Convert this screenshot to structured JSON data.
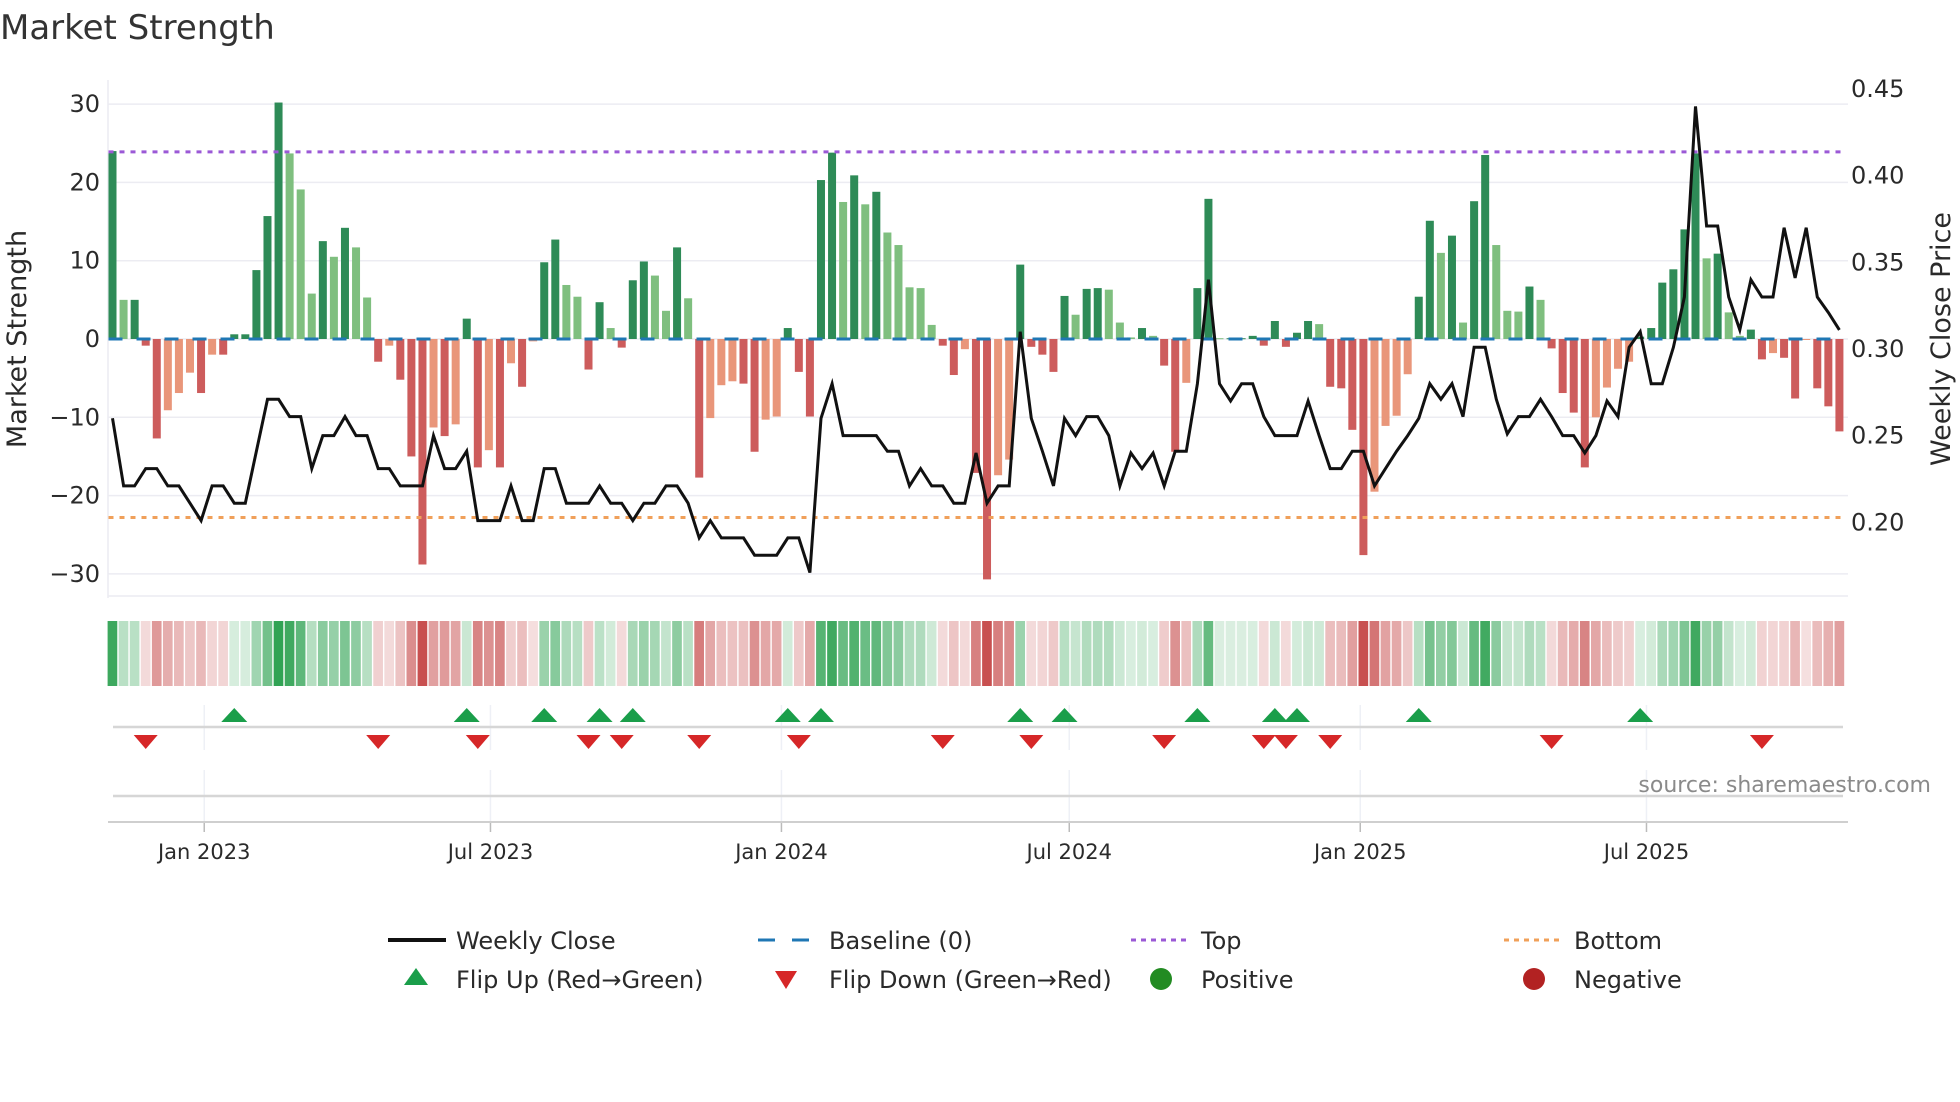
{
  "title": "Market Strength",
  "source": "source: sharemaestro.com",
  "colors": {
    "pos_strong": "#2e8b57",
    "pos_weak": "#7fbf7f",
    "neg_strong": "#cd5c5c",
    "neg_weak": "#e9967a",
    "line": "#111111",
    "baseline": "#1f77b4",
    "top": "#9b59d6",
    "bottom": "#f0a05a",
    "flip_up": "#1a9e4a",
    "flip_down": "#d62728",
    "positive": "#228b22",
    "negative": "#b22222"
  },
  "chart_data": {
    "type": "bar",
    "title": "Market Strength",
    "ylabel": "Market Strength",
    "y2label": "Weekly Close Price",
    "ylim": [
      -33,
      33
    ],
    "y2lim": [
      0.155,
      0.455
    ],
    "yticks": [
      "30",
      "20",
      "10",
      "0",
      "−10",
      "−20",
      "−30"
    ],
    "ytick_values": [
      30,
      20,
      10,
      0,
      -10,
      -20,
      -30
    ],
    "y2ticks": [
      "0.45",
      "0.40",
      "0.35",
      "0.30",
      "0.25",
      "0.20"
    ],
    "y2tick_values": [
      0.45,
      0.4,
      0.35,
      0.3,
      0.25,
      0.2
    ],
    "x_frequency": "weekly",
    "x_start": "2022-11-04",
    "x_ticks": [
      {
        "label": "Jan 2023",
        "date": "2023-01-01"
      },
      {
        "label": "Jul 2023",
        "date": "2023-07-01"
      },
      {
        "label": "Jan 2024",
        "date": "2024-01-01"
      },
      {
        "label": "Jul 2024",
        "date": "2024-07-01"
      },
      {
        "label": "Jan 2025",
        "date": "2025-01-01"
      },
      {
        "label": "Jul 2025",
        "date": "2025-07-01"
      }
    ],
    "top_level": 23.9,
    "bottom_level": -22.8,
    "baseline": 0,
    "strength": [
      24.0,
      5.0,
      5.0,
      -0.85,
      -12.7,
      -9.1,
      -6.9,
      -4.3,
      -6.9,
      -2.0,
      -2.0,
      0.6,
      0.6,
      8.8,
      15.7,
      30.2,
      23.7,
      19.1,
      5.8,
      12.5,
      10.5,
      14.2,
      11.7,
      5.3,
      -2.9,
      -0.85,
      -5.2,
      -15.0,
      -28.8,
      -11.3,
      -12.4,
      -10.9,
      2.6,
      -16.4,
      -14.2,
      -16.4,
      -3.1,
      -6.1,
      -0.3,
      9.8,
      12.7,
      6.9,
      5.4,
      -3.9,
      4.7,
      1.4,
      -1.1,
      7.5,
      9.9,
      8.1,
      3.6,
      11.7,
      5.2,
      -17.7,
      -10.1,
      -5.9,
      -5.4,
      -5.7,
      -14.4,
      -10.3,
      -9.9,
      1.4,
      -4.2,
      -9.9,
      20.3,
      23.8,
      17.5,
      20.9,
      17.2,
      18.8,
      13.6,
      12.0,
      6.6,
      6.5,
      1.8,
      -0.85,
      -4.6,
      -1.3,
      -17.1,
      -30.7,
      -17.4,
      -15.4,
      9.5,
      -1.0,
      -2.0,
      -4.2,
      5.5,
      3.1,
      6.4,
      6.5,
      6.3,
      2.1,
      0.2,
      1.4,
      0.4,
      -3.4,
      -14.4,
      -5.6,
      6.5,
      17.9,
      0.1,
      0.1,
      0.1,
      0.4,
      -0.85,
      2.3,
      -1.0,
      0.8,
      2.3,
      1.9,
      -6.1,
      -6.3,
      -11.6,
      -27.6,
      -19.5,
      -11.1,
      -9.8,
      -4.5,
      5.4,
      15.1,
      11.0,
      13.2,
      2.1,
      17.6,
      23.5,
      12.0,
      3.6,
      3.5,
      6.7,
      5.0,
      -1.2,
      -6.9,
      -9.4,
      -16.4,
      -10.0,
      -6.2,
      -3.8,
      -2.9,
      0.3,
      1.4,
      7.2,
      8.9,
      14.0,
      23.7,
      10.3,
      10.9,
      3.4,
      0.4,
      1.2,
      -2.6,
      -1.8,
      -2.4,
      -7.6,
      -0.1,
      -6.3,
      -8.6,
      -11.8
    ],
    "weekly_close": [
      0.26,
      0.221,
      0.221,
      0.231,
      0.231,
      0.221,
      0.221,
      0.211,
      0.201,
      0.221,
      0.221,
      0.211,
      0.211,
      0.241,
      0.271,
      0.271,
      0.261,
      0.261,
      0.231,
      0.25,
      0.25,
      0.261,
      0.25,
      0.25,
      0.231,
      0.231,
      0.221,
      0.221,
      0.221,
      0.25,
      0.231,
      0.231,
      0.241,
      0.201,
      0.201,
      0.201,
      0.221,
      0.201,
      0.201,
      0.231,
      0.231,
      0.211,
      0.211,
      0.211,
      0.221,
      0.211,
      0.211,
      0.201,
      0.211,
      0.211,
      0.221,
      0.221,
      0.211,
      0.191,
      0.201,
      0.191,
      0.191,
      0.191,
      0.181,
      0.181,
      0.181,
      0.191,
      0.191,
      0.171,
      0.26,
      0.28,
      0.25,
      0.25,
      0.25,
      0.25,
      0.241,
      0.241,
      0.221,
      0.231,
      0.221,
      0.221,
      0.211,
      0.211,
      0.24,
      0.211,
      0.221,
      0.221,
      0.31,
      0.26,
      0.241,
      0.221,
      0.26,
      0.25,
      0.261,
      0.261,
      0.25,
      0.221,
      0.24,
      0.231,
      0.24,
      0.221,
      0.241,
      0.241,
      0.28,
      0.34,
      0.28,
      0.27,
      0.28,
      0.28,
      0.261,
      0.25,
      0.25,
      0.25,
      0.27,
      0.25,
      0.231,
      0.231,
      0.241,
      0.241,
      0.221,
      0.231,
      0.241,
      0.25,
      0.26,
      0.28,
      0.271,
      0.28,
      0.261,
      0.301,
      0.301,
      0.271,
      0.251,
      0.261,
      0.261,
      0.271,
      0.261,
      0.25,
      0.25,
      0.24,
      0.25,
      0.27,
      0.261,
      0.301,
      0.31,
      0.28,
      0.28,
      0.301,
      0.33,
      0.44,
      0.371,
      0.371,
      0.33,
      0.311,
      0.34,
      0.33,
      0.33,
      0.37,
      0.341,
      0.37,
      0.33,
      0.321,
      0.311
    ],
    "legend": {
      "placement": "bottom",
      "items": [
        {
          "label": "Weekly Close",
          "kind": "line"
        },
        {
          "label": "Baseline (0)",
          "kind": "dash"
        },
        {
          "label": "Top",
          "kind": "dot-top"
        },
        {
          "label": "Bottom",
          "kind": "dot-bottom"
        },
        {
          "label": "Flip Up (Red→Green)",
          "kind": "tri-up"
        },
        {
          "label": "Flip Down (Green→Red)",
          "kind": "tri-down"
        },
        {
          "label": "Positive",
          "kind": "circle-pos"
        },
        {
          "label": "Negative",
          "kind": "circle-neg"
        }
      ]
    }
  }
}
